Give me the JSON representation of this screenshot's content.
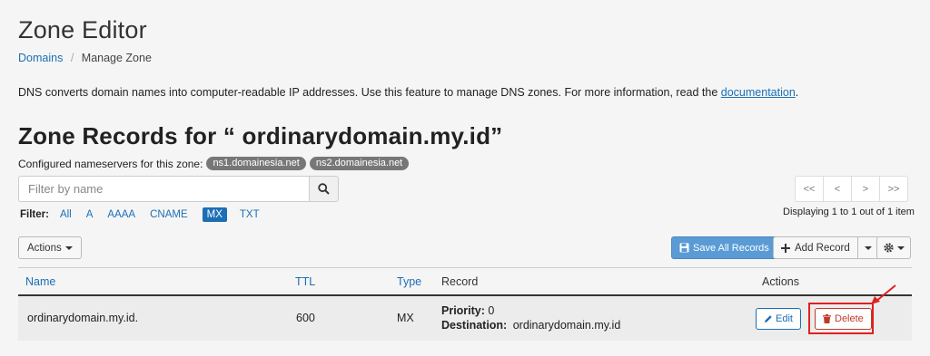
{
  "page": {
    "title": "Zone Editor",
    "breadcrumb": {
      "parent": "Domains",
      "separator": "/",
      "current": "Manage Zone"
    },
    "description": "DNS converts domain names into computer-readable IP addresses. Use this feature to manage DNS zones. For more information, read the ",
    "description_link": "documentation",
    "description_end": "."
  },
  "zone": {
    "heading": "Zone Records for “ ordinarydomain.my.id”",
    "nameservers_label": "Configured nameservers for this zone:",
    "nameservers": [
      "ns1.domainesia.net",
      "ns2.domainesia.net"
    ]
  },
  "search": {
    "placeholder": "Filter by name",
    "value": ""
  },
  "filter": {
    "label": "Filter:",
    "options": [
      "All",
      "A",
      "AAAA",
      "CNAME",
      "MX",
      "TXT"
    ],
    "active": "MX"
  },
  "pagination": {
    "buttons": [
      "<<",
      "<",
      ">",
      ">>"
    ],
    "status": "Displaying 1 to 1 out of 1 item"
  },
  "toolbar": {
    "actions_label": "Actions",
    "save_all_label": "Save All Records",
    "add_record_label": "Add Record"
  },
  "table": {
    "headers": {
      "name": "Name",
      "ttl": "TTL",
      "type": "Type",
      "record": "Record",
      "actions": "Actions"
    },
    "rows": [
      {
        "name": "ordinarydomain.my.id.",
        "ttl": "600",
        "type": "MX",
        "priority_label": "Priority:",
        "priority": "0",
        "destination_label": "Destination:",
        "destination": "ordinarydomain.my.id",
        "edit_label": "Edit",
        "delete_label": "Delete"
      }
    ]
  },
  "colors": {
    "link": "#1b6fb5",
    "primary_button": "#5a9bd5",
    "danger": "#c0392b",
    "annotation": "#e02020",
    "badge": "#777777"
  },
  "icons": {
    "search": "search-icon",
    "save": "floppy-disk-icon",
    "add": "plus-icon",
    "settings": "gear-icon",
    "edit": "pencil-icon",
    "delete": "trash-icon"
  }
}
